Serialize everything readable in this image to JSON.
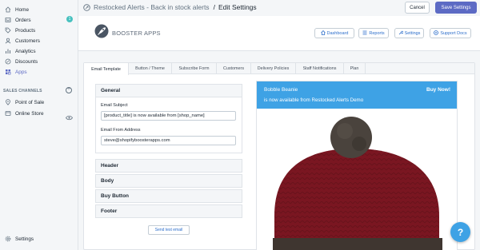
{
  "sidebar": {
    "items": [
      {
        "label": "Home",
        "icon": "home-icon"
      },
      {
        "label": "Orders",
        "icon": "orders-icon",
        "badge": "1"
      },
      {
        "label": "Products",
        "icon": "tag-icon"
      },
      {
        "label": "Customers",
        "icon": "person-icon"
      },
      {
        "label": "Analytics",
        "icon": "bar-chart-icon"
      },
      {
        "label": "Discounts",
        "icon": "discount-icon"
      },
      {
        "label": "Apps",
        "icon": "apps-icon",
        "active": true
      }
    ],
    "sales_channels_label": "SALES CHANNELS",
    "channels": [
      {
        "label": "Point of Sale",
        "icon": "pos-icon"
      },
      {
        "label": "Online Store",
        "icon": "store-icon"
      }
    ],
    "settings_label": "Settings"
  },
  "topbar": {
    "app_name": "Restocked Alerts - Back in stock alerts",
    "separator": "/",
    "page": "Edit Settings",
    "cancel_label": "Cancel",
    "save_label": "Save Settings"
  },
  "app_header": {
    "logo_text": "BOOSTER APPS",
    "buttons": {
      "dashboard": "Dashboard",
      "reports": "Reports",
      "settings": "Settings",
      "support": "Support Docs"
    }
  },
  "tabs": [
    "Email Template",
    "Button / Theme",
    "Subscribe Form",
    "Customers",
    "Delivery Policies",
    "Staff Notifications",
    "Plan"
  ],
  "form": {
    "general_title": "General",
    "subject_label": "Email Subject",
    "subject_value": "[product_title] is now available from [shop_name]",
    "from_label": "Email From Address",
    "from_value": "steve@shopifyboosterapps.com",
    "sections": [
      "Header",
      "Body",
      "Buy Button",
      "Footer"
    ],
    "test_button": "Send test email"
  },
  "preview": {
    "product_name": "Bobble Beanie",
    "buy_label": "Buy Now!",
    "subtitle": "is now available from Restocked Alerts Demo"
  },
  "help_label": "?",
  "colors": {
    "accent": "#5c6ac4",
    "banner": "#3ea2e5",
    "badge": "#47c1bf",
    "link": "#2c6ecb"
  }
}
